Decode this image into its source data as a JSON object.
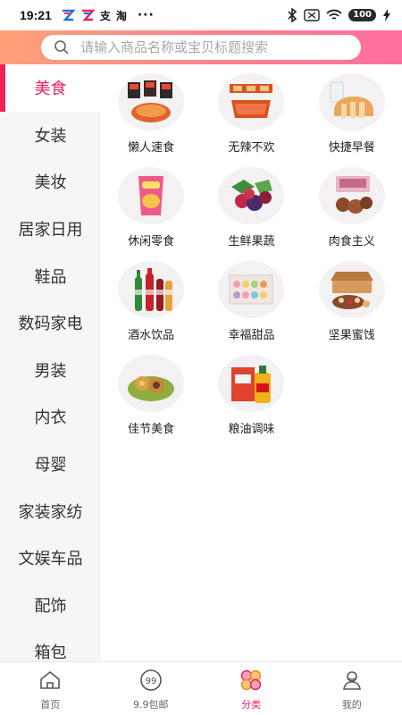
{
  "status_bar": {
    "time": "19:21",
    "app_labels": [
      "支",
      "淘"
    ],
    "dots": "···",
    "battery": "100"
  },
  "search": {
    "placeholder": "请输入商品名称或宝贝标题搜索",
    "value": ""
  },
  "sidebar": {
    "items": [
      {
        "label": "美食",
        "active": true
      },
      {
        "label": "女装"
      },
      {
        "label": "美妆"
      },
      {
        "label": "居家日用"
      },
      {
        "label": "鞋品"
      },
      {
        "label": "数码家电"
      },
      {
        "label": "男装"
      },
      {
        "label": "内衣"
      },
      {
        "label": "母婴"
      },
      {
        "label": "家装家纺"
      },
      {
        "label": "文娱车品"
      },
      {
        "label": "配饰"
      },
      {
        "label": "箱包"
      }
    ]
  },
  "categories": [
    {
      "label": "懒人速食",
      "icon": "instant-food-icon"
    },
    {
      "label": "无辣不欢",
      "icon": "spicy-snack-icon"
    },
    {
      "label": "快捷早餐",
      "icon": "breakfast-bread-icon"
    },
    {
      "label": "休闲零食",
      "icon": "chips-bag-icon"
    },
    {
      "label": "生鲜果蔬",
      "icon": "fresh-berries-icon"
    },
    {
      "label": "肉食主义",
      "icon": "meat-icon"
    },
    {
      "label": "酒水饮品",
      "icon": "drinks-bottles-icon"
    },
    {
      "label": "幸福甜品",
      "icon": "macaron-box-icon"
    },
    {
      "label": "坚果蜜饯",
      "icon": "nuts-box-icon"
    },
    {
      "label": "佳节美食",
      "icon": "mooncake-icon"
    },
    {
      "label": "粮油调味",
      "icon": "oil-rice-icon"
    }
  ],
  "tabbar": {
    "items": [
      {
        "label": "首页",
        "icon": "home-icon"
      },
      {
        "label": "9.9包邮",
        "icon": "nine-nine-icon"
      },
      {
        "label": "分类",
        "icon": "category-icon",
        "active": true
      },
      {
        "label": "我的",
        "icon": "profile-icon"
      }
    ]
  },
  "colors": {
    "accent": "#f0215a",
    "search_gradient": [
      "#ffa07a",
      "#ff6f9e"
    ]
  }
}
